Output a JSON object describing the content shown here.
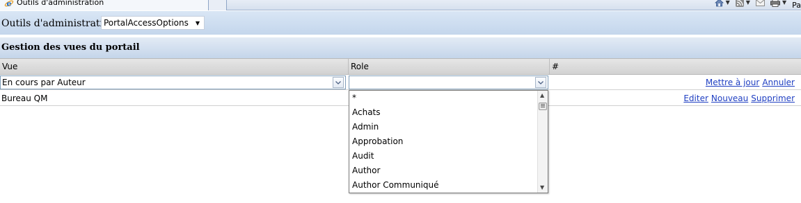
{
  "browser": {
    "tab_title": "Outils d'administration",
    "page_menu_label": "Pa",
    "icons": [
      "ie-logo-icon",
      "home-icon",
      "rss-feed-icon",
      "mail-icon",
      "print-icon"
    ]
  },
  "admin_bar": {
    "label": "Outils d'administration :",
    "select_value": "PortalAccessOptions"
  },
  "section": {
    "title": "Gestion des vues du portail"
  },
  "grid": {
    "columns": [
      "Vue",
      "Role",
      "#"
    ],
    "edit_row": {
      "vue_value": "En cours par Auteur",
      "role_value": "",
      "actions": [
        "Mettre à jour",
        "Annuler"
      ]
    },
    "rows": [
      {
        "vue": "Bureau QM",
        "actions": [
          "Editer",
          "Nouveau",
          "Supprimer"
        ]
      }
    ]
  },
  "role_dropdown": {
    "options": [
      "*",
      "Achats",
      "Admin",
      "Approbation",
      "Audit",
      "Author",
      "Author Communiqué"
    ]
  },
  "colors": {
    "link": "#1f3fc2",
    "bar_blue": "#c4d6ec"
  }
}
